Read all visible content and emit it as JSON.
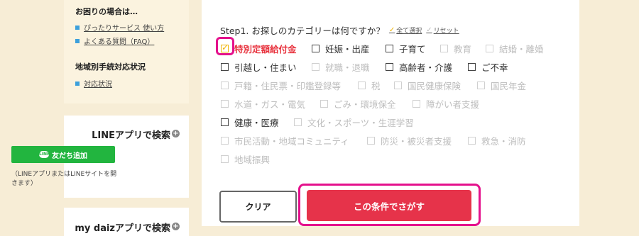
{
  "sidebar": {
    "help": {
      "title": "お困りの場合は…",
      "links": [
        "ぴったりサービス 使い方",
        "よくある質問（FAQ）"
      ],
      "section_title": "地域別手続対応状況",
      "status_link": "対応状況"
    },
    "line": {
      "title": "LINEアプリで検索",
      "button_label": "友だち追加",
      "badge": "LINE",
      "note": "（LINEアプリまたはLINEサイトを開きます）"
    },
    "mydaiz": {
      "title": "my daizアプリで検索"
    }
  },
  "main": {
    "step_prompt": "Step1. お探しのカテゴリーは何ですか？",
    "select_all": "全て選択",
    "reset": "リセット",
    "categories": [
      {
        "label": "特別定額給付金",
        "state": "checked"
      },
      {
        "label": "妊娠・出産",
        "state": "enabled"
      },
      {
        "label": "子育て",
        "state": "enabled"
      },
      {
        "label": "教育",
        "state": "disabled"
      },
      {
        "label": "結婚・離婚",
        "state": "disabled"
      },
      {
        "label": "引越し・住まい",
        "state": "enabled"
      },
      {
        "label": "就職・退職",
        "state": "disabled"
      },
      {
        "label": "高齢者・介護",
        "state": "enabled"
      },
      {
        "label": "ご不幸",
        "state": "enabled"
      },
      {
        "label": "戸籍・住民票・印鑑登録等",
        "state": "disabled"
      },
      {
        "label": "税",
        "state": "disabled"
      },
      {
        "label": "国民健康保険",
        "state": "disabled"
      },
      {
        "label": "国民年金",
        "state": "disabled"
      },
      {
        "label": "水道・ガス・電気",
        "state": "disabled"
      },
      {
        "label": "ごみ・環境保全",
        "state": "disabled"
      },
      {
        "label": "障がい者支援",
        "state": "disabled"
      },
      {
        "label": "健康・医療",
        "state": "enabled"
      },
      {
        "label": "文化・スポーツ・生涯学習",
        "state": "disabled"
      },
      {
        "label": "市民活動・地域コミュニティ",
        "state": "disabled"
      },
      {
        "label": "防災・被災者支援",
        "state": "disabled"
      },
      {
        "label": "救急・消防",
        "state": "disabled"
      },
      {
        "label": "地域振興",
        "state": "disabled"
      }
    ],
    "clear_label": "クリア",
    "search_label": "この条件でさがす"
  },
  "colors": {
    "accent": "#e6334a",
    "highlight": "#e4118c",
    "check": "#f0b300",
    "line_green": "#22b53f"
  }
}
